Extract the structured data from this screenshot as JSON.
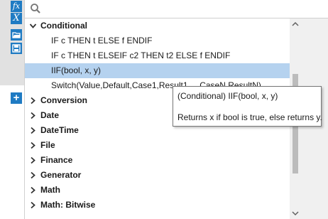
{
  "search": {
    "placeholder": "",
    "value": ""
  },
  "toolbar": {
    "buttons": [
      {
        "icon": "fx-function-icon",
        "glyph": "fx"
      },
      {
        "icon": "variable-x-icon",
        "glyph": "X"
      },
      {
        "icon": "open-folder-icon"
      },
      {
        "icon": "save-disk-icon"
      }
    ],
    "add_button_glyph": "+"
  },
  "tree": {
    "expanded_category": "Conditional",
    "expanded_items": [
      "IF c THEN t ELSE f ENDIF",
      "IF c THEN t ELSEIF c2 THEN t2 ELSE f ENDIF",
      "IIF(bool, x, y)",
      "Switch(Value,Default,Case1,Result1,...,CaseN,ResultN)"
    ],
    "selected_item": "IIF(bool, x, y)",
    "collapsed_categories": [
      "Conversion",
      "Date",
      "DateTime",
      "File",
      "Finance",
      "Generator",
      "Math",
      "Math: Bitwise"
    ]
  },
  "tooltip": {
    "title": "(Conditional) IIF(bool, x, y)",
    "description": "Returns x if bool is true, else returns y."
  },
  "colors": {
    "accent": "#1f7bc3",
    "selection": "#b5d2ef",
    "left_panel": "#e1e1e1",
    "scroll_thumb": "#bcbcbc"
  }
}
